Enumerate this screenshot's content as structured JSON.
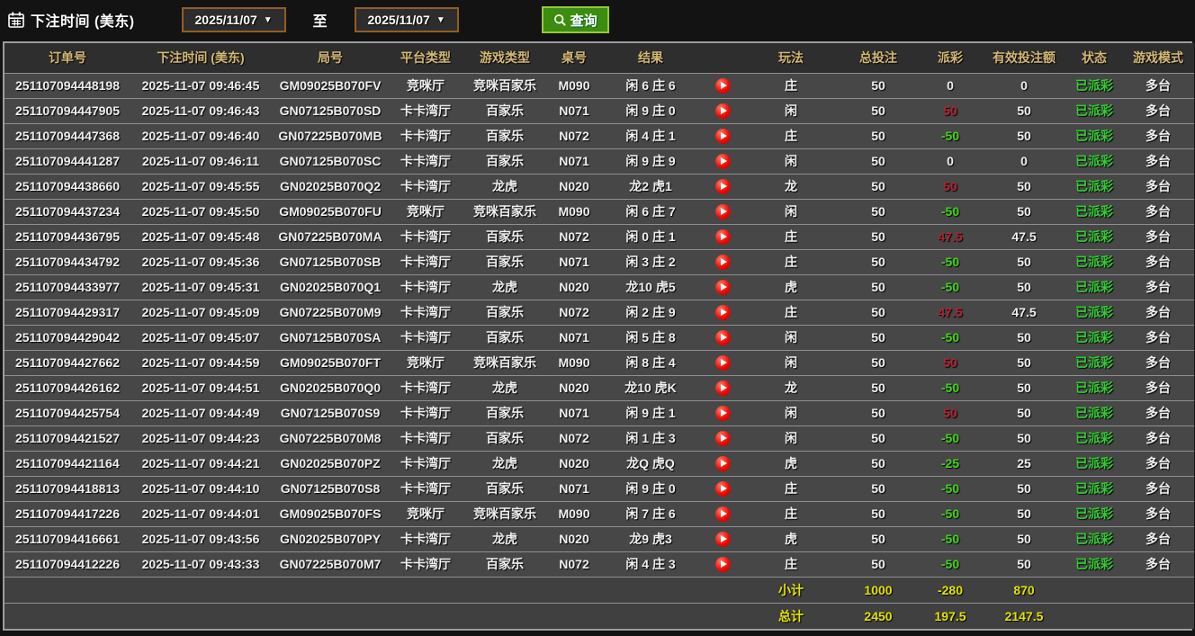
{
  "toolbar": {
    "label": "下注时间 (美东)",
    "date_from": "2025/11/07",
    "to_label": "至",
    "date_to": "2025/11/07",
    "query_label": "查询"
  },
  "colors": {
    "header_gold": "#d4b873",
    "payout_positive_red": "#b32230",
    "payout_negative_green": "#3fd414",
    "status_paid_green": "#33cc33",
    "totals_yellow": "#e2e200",
    "query_button_green": "#3c8c10",
    "date_border_brown": "#925e20"
  },
  "table": {
    "headers": [
      "订单号",
      "下注时间 (美东)",
      "局号",
      "平台类型",
      "游戏类型",
      "桌号",
      "结果",
      "",
      "玩法",
      "总投注",
      "派彩",
      "有效投注额",
      "状态",
      "游戏模式"
    ],
    "play_icon_name": "replay-video-icon",
    "rows": [
      {
        "order": "251107094448198",
        "time": "2025-11-07 09:46:45",
        "round": "GM09025B070FV",
        "platform": "竞咪厅",
        "game": "竞咪百家乐",
        "table_no": "M090",
        "result": "闲 6 庄 6",
        "play": "庄",
        "bet": "50",
        "payout": "0",
        "payout_class": "zero",
        "valid": "0",
        "status": "已派彩",
        "mode": "多台"
      },
      {
        "order": "251107094447905",
        "time": "2025-11-07 09:46:43",
        "round": "GN07125B070SD",
        "platform": "卡卡湾厅",
        "game": "百家乐",
        "table_no": "N071",
        "result": "闲 9 庄 0",
        "play": "闲",
        "bet": "50",
        "payout": "50",
        "payout_class": "pos",
        "valid": "50",
        "status": "已派彩",
        "mode": "多台"
      },
      {
        "order": "251107094447368",
        "time": "2025-11-07 09:46:40",
        "round": "GN07225B070MB",
        "platform": "卡卡湾厅",
        "game": "百家乐",
        "table_no": "N072",
        "result": "闲 4 庄 1",
        "play": "庄",
        "bet": "50",
        "payout": "-50",
        "payout_class": "neg",
        "valid": "50",
        "status": "已派彩",
        "mode": "多台"
      },
      {
        "order": "251107094441287",
        "time": "2025-11-07 09:46:11",
        "round": "GN07125B070SC",
        "platform": "卡卡湾厅",
        "game": "百家乐",
        "table_no": "N071",
        "result": "闲 9 庄 9",
        "play": "闲",
        "bet": "50",
        "payout": "0",
        "payout_class": "zero",
        "valid": "0",
        "status": "已派彩",
        "mode": "多台"
      },
      {
        "order": "251107094438660",
        "time": "2025-11-07 09:45:55",
        "round": "GN02025B070Q2",
        "platform": "卡卡湾厅",
        "game": "龙虎",
        "table_no": "N020",
        "result": "龙2 虎1",
        "play": "龙",
        "bet": "50",
        "payout": "50",
        "payout_class": "pos",
        "valid": "50",
        "status": "已派彩",
        "mode": "多台"
      },
      {
        "order": "251107094437234",
        "time": "2025-11-07 09:45:50",
        "round": "GM09025B070FU",
        "platform": "竞咪厅",
        "game": "竞咪百家乐",
        "table_no": "M090",
        "result": "闲 6 庄 7",
        "play": "闲",
        "bet": "50",
        "payout": "-50",
        "payout_class": "neg",
        "valid": "50",
        "status": "已派彩",
        "mode": "多台"
      },
      {
        "order": "251107094436795",
        "time": "2025-11-07 09:45:48",
        "round": "GN07225B070MA",
        "platform": "卡卡湾厅",
        "game": "百家乐",
        "table_no": "N072",
        "result": "闲 0 庄 1",
        "play": "庄",
        "bet": "50",
        "payout": "47.5",
        "payout_class": "pos",
        "valid": "47.5",
        "status": "已派彩",
        "mode": "多台"
      },
      {
        "order": "251107094434792",
        "time": "2025-11-07 09:45:36",
        "round": "GN07125B070SB",
        "platform": "卡卡湾厅",
        "game": "百家乐",
        "table_no": "N071",
        "result": "闲 3 庄 2",
        "play": "庄",
        "bet": "50",
        "payout": "-50",
        "payout_class": "neg",
        "valid": "50",
        "status": "已派彩",
        "mode": "多台"
      },
      {
        "order": "251107094433977",
        "time": "2025-11-07 09:45:31",
        "round": "GN02025B070Q1",
        "platform": "卡卡湾厅",
        "game": "龙虎",
        "table_no": "N020",
        "result": "龙10 虎5",
        "play": "虎",
        "bet": "50",
        "payout": "-50",
        "payout_class": "neg",
        "valid": "50",
        "status": "已派彩",
        "mode": "多台"
      },
      {
        "order": "251107094429317",
        "time": "2025-11-07 09:45:09",
        "round": "GN07225B070M9",
        "platform": "卡卡湾厅",
        "game": "百家乐",
        "table_no": "N072",
        "result": "闲 2 庄 9",
        "play": "庄",
        "bet": "50",
        "payout": "47.5",
        "payout_class": "pos",
        "valid": "47.5",
        "status": "已派彩",
        "mode": "多台"
      },
      {
        "order": "251107094429042",
        "time": "2025-11-07 09:45:07",
        "round": "GN07125B070SA",
        "platform": "卡卡湾厅",
        "game": "百家乐",
        "table_no": "N071",
        "result": "闲 5 庄 8",
        "play": "闲",
        "bet": "50",
        "payout": "-50",
        "payout_class": "neg",
        "valid": "50",
        "status": "已派彩",
        "mode": "多台"
      },
      {
        "order": "251107094427662",
        "time": "2025-11-07 09:44:59",
        "round": "GM09025B070FT",
        "platform": "竞咪厅",
        "game": "竞咪百家乐",
        "table_no": "M090",
        "result": "闲 8 庄 4",
        "play": "闲",
        "bet": "50",
        "payout": "50",
        "payout_class": "pos",
        "valid": "50",
        "status": "已派彩",
        "mode": "多台"
      },
      {
        "order": "251107094426162",
        "time": "2025-11-07 09:44:51",
        "round": "GN02025B070Q0",
        "platform": "卡卡湾厅",
        "game": "龙虎",
        "table_no": "N020",
        "result": "龙10 虎K",
        "play": "龙",
        "bet": "50",
        "payout": "-50",
        "payout_class": "neg",
        "valid": "50",
        "status": "已派彩",
        "mode": "多台"
      },
      {
        "order": "251107094425754",
        "time": "2025-11-07 09:44:49",
        "round": "GN07125B070S9",
        "platform": "卡卡湾厅",
        "game": "百家乐",
        "table_no": "N071",
        "result": "闲 9 庄 1",
        "play": "闲",
        "bet": "50",
        "payout": "50",
        "payout_class": "pos",
        "valid": "50",
        "status": "已派彩",
        "mode": "多台"
      },
      {
        "order": "251107094421527",
        "time": "2025-11-07 09:44:23",
        "round": "GN07225B070M8",
        "platform": "卡卡湾厅",
        "game": "百家乐",
        "table_no": "N072",
        "result": "闲 1 庄 3",
        "play": "闲",
        "bet": "50",
        "payout": "-50",
        "payout_class": "neg",
        "valid": "50",
        "status": "已派彩",
        "mode": "多台"
      },
      {
        "order": "251107094421164",
        "time": "2025-11-07 09:44:21",
        "round": "GN02025B070PZ",
        "platform": "卡卡湾厅",
        "game": "龙虎",
        "table_no": "N020",
        "result": "龙Q 虎Q",
        "play": "虎",
        "bet": "50",
        "payout": "-25",
        "payout_class": "neg",
        "valid": "25",
        "status": "已派彩",
        "mode": "多台"
      },
      {
        "order": "251107094418813",
        "time": "2025-11-07 09:44:10",
        "round": "GN07125B070S8",
        "platform": "卡卡湾厅",
        "game": "百家乐",
        "table_no": "N071",
        "result": "闲 9 庄 0",
        "play": "庄",
        "bet": "50",
        "payout": "-50",
        "payout_class": "neg",
        "valid": "50",
        "status": "已派彩",
        "mode": "多台"
      },
      {
        "order": "251107094417226",
        "time": "2025-11-07 09:44:01",
        "round": "GM09025B070FS",
        "platform": "竞咪厅",
        "game": "竞咪百家乐",
        "table_no": "M090",
        "result": "闲 7 庄 6",
        "play": "庄",
        "bet": "50",
        "payout": "-50",
        "payout_class": "neg",
        "valid": "50",
        "status": "已派彩",
        "mode": "多台"
      },
      {
        "order": "251107094416661",
        "time": "2025-11-07 09:43:56",
        "round": "GN02025B070PY",
        "platform": "卡卡湾厅",
        "game": "龙虎",
        "table_no": "N020",
        "result": "龙9 虎3",
        "play": "虎",
        "bet": "50",
        "payout": "-50",
        "payout_class": "neg",
        "valid": "50",
        "status": "已派彩",
        "mode": "多台"
      },
      {
        "order": "251107094412226",
        "time": "2025-11-07 09:43:33",
        "round": "GN07225B070M7",
        "platform": "卡卡湾厅",
        "game": "百家乐",
        "table_no": "N072",
        "result": "闲 4 庄 3",
        "play": "庄",
        "bet": "50",
        "payout": "-50",
        "payout_class": "neg",
        "valid": "50",
        "status": "已派彩",
        "mode": "多台"
      }
    ],
    "subtotal": {
      "label": "小计",
      "bet": "1000",
      "payout": "-280",
      "valid": "870"
    },
    "total": {
      "label": "总计",
      "bet": "2450",
      "payout": "197.5",
      "valid": "2147.5"
    }
  }
}
